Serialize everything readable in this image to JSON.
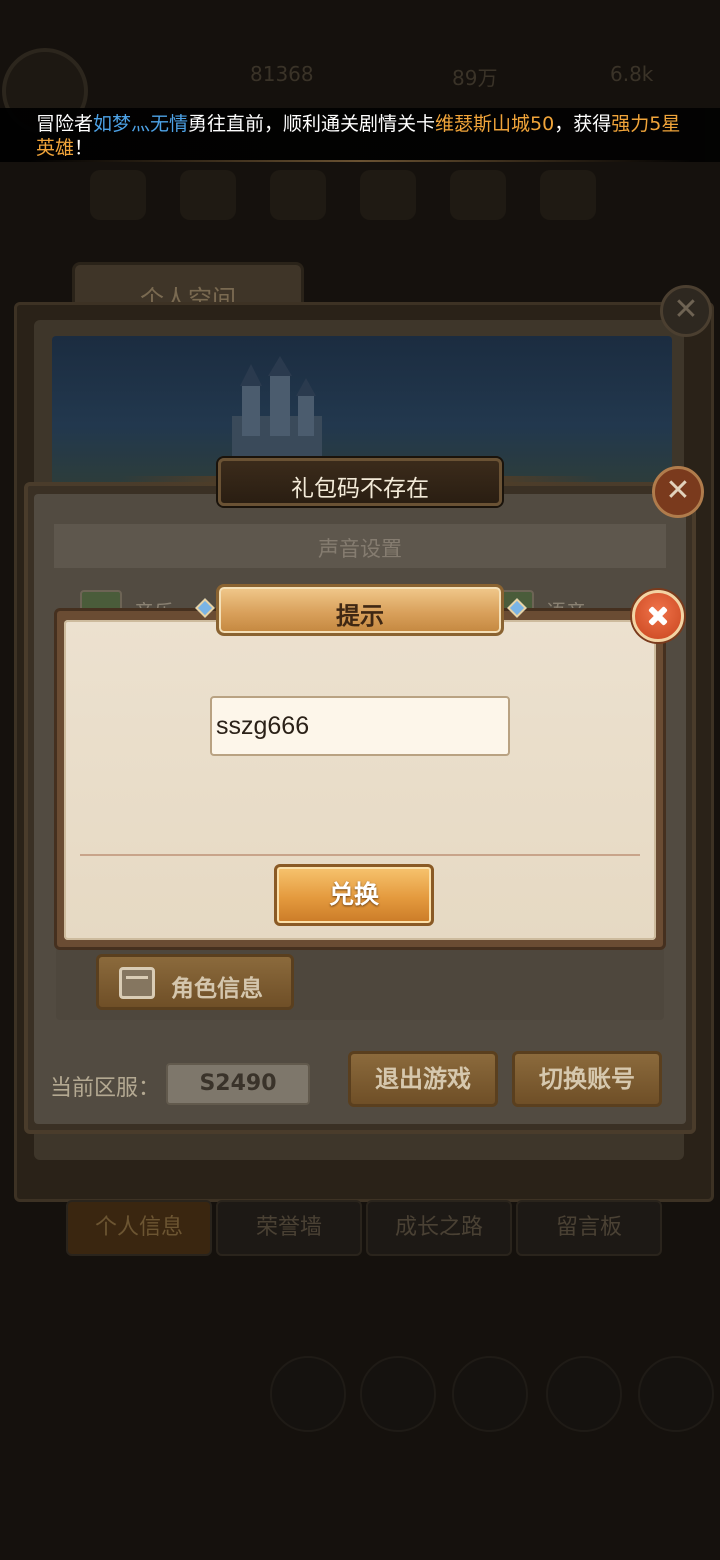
{
  "background": {
    "resources": [
      "81368",
      "89万",
      "6.8k"
    ],
    "space_window": {
      "tab_title": "个人空间",
      "bottom_tabs": [
        "个人信息",
        "荣誉墙",
        "成长之路",
        "留言板"
      ]
    }
  },
  "broadcast": {
    "prefix": "冒险者",
    "player_name": "如梦灬无情",
    "middle": "勇往直前，顺利通关剧情关卡",
    "stage_name": "维瑟斯山城50",
    "action": "，获得",
    "reward": "强力5星英雄",
    "suffix": "！"
  },
  "settings": {
    "sound_section": "声音设置",
    "music_label": "音乐",
    "voice_label": "语音",
    "role_info_button": "角色信息",
    "server_label": "当前区服：",
    "server_value": "S2490",
    "exit_button": "退出游戏",
    "switch_account_button": "切换账号"
  },
  "gift_code_window": {
    "title": "礼包码不存在"
  },
  "prompt": {
    "title": "提示",
    "code_value": "sszg666",
    "redeem_button": "兑换"
  },
  "colors": {
    "player_name": "#4da2e6",
    "highlight": "#f0a43a",
    "button_gold": "#e49a3e",
    "close_red": "#c8451e"
  }
}
